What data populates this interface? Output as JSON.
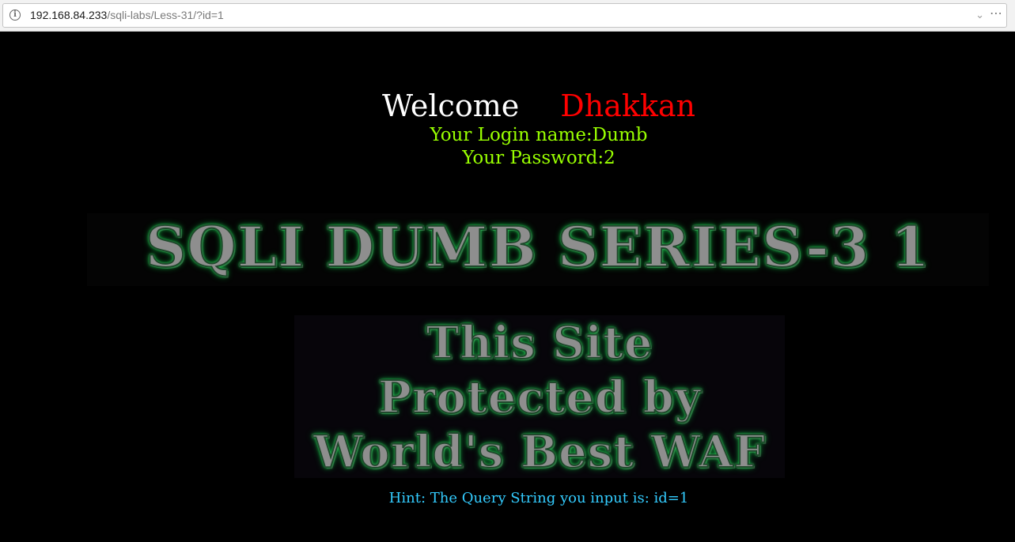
{
  "browser": {
    "url_host": "192.168.84.233",
    "url_path": "/sqli-labs/Less-31/?id=1",
    "info_icon": "info-icon",
    "chevron_icon": "chevron-down-icon",
    "more_icon": "more-options-icon"
  },
  "page": {
    "welcome": "Welcome",
    "user_name": "Dhakkan",
    "login_line": "Your Login name:Dumb",
    "password_line": "Your Password:2",
    "banner_title": "SQLI DUMB SERIES-3 1",
    "waf_lines": [
      "This Site",
      "Protected by",
      "World's Best WAF"
    ],
    "hint": "Hint: The Query String you input is: id=1"
  },
  "colors": {
    "background": "#000000",
    "welcome": "#ffffff",
    "user_name": "#ff0000",
    "credentials": "#99ff00",
    "hint": "#33ccff",
    "glow": "#22d455"
  }
}
